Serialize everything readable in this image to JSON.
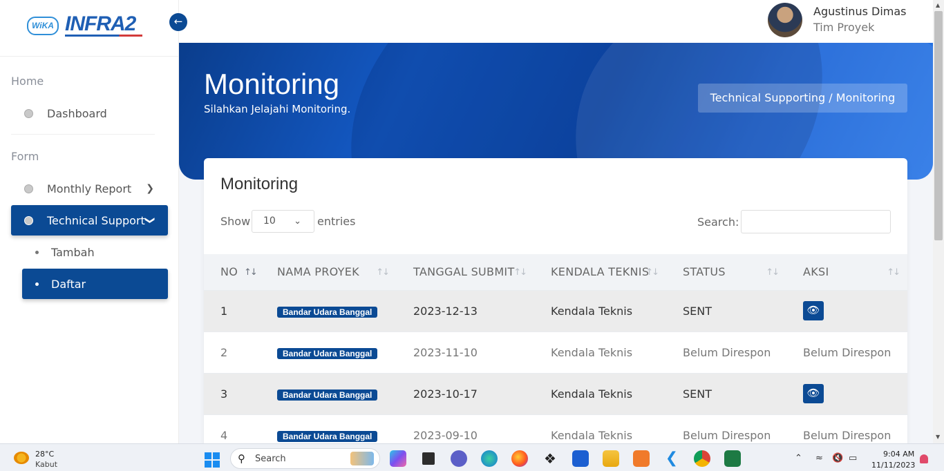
{
  "brand": {
    "logo_left": "WiKA",
    "logo_right": "INFRA2"
  },
  "sidebar": {
    "sections": [
      {
        "label": "Home"
      },
      {
        "label": "Form"
      }
    ],
    "items": [
      {
        "label": "Dashboard"
      },
      {
        "label": "Monthly Report"
      },
      {
        "label": "Technical Support"
      }
    ],
    "subitems": [
      {
        "label": "Tambah"
      },
      {
        "label": "Daftar"
      }
    ]
  },
  "user": {
    "name": "Agustinus Dimas",
    "role": "Tim Proyek"
  },
  "hero": {
    "title": "Monitoring",
    "subtitle": "Silahkan Jelajahi Monitoring.",
    "breadcrumb": "Technical Supporting / Monitoring"
  },
  "card": {
    "title": "Monitoring",
    "show_label": "Show",
    "entries_value": "10",
    "entries_label": "entries",
    "search_label": "Search:",
    "search_value": ""
  },
  "table": {
    "headers": [
      "NO",
      "NAMA PROYEK",
      "TANGGAL SUBMIT",
      "KENDALA TEKNIS",
      "STATUS",
      "AKSI"
    ],
    "rows": [
      {
        "no": "1",
        "proyek": "Bandar Udara Banggal",
        "tanggal": "2023-12-13",
        "kendala": "Kendala Teknis",
        "status": "SENT",
        "aksi": "eye-icon"
      },
      {
        "no": "2",
        "proyek": "Bandar Udara Banggal",
        "tanggal": "2023-11-10",
        "kendala": "Kendala Teknis",
        "status": "Belum Direspon",
        "aksi": "Belum Direspon"
      },
      {
        "no": "3",
        "proyek": "Bandar Udara Banggal",
        "tanggal": "2023-10-17",
        "kendala": "Kendala Teknis",
        "status": "SENT",
        "aksi": "eye-icon"
      },
      {
        "no": "4",
        "proyek": "Bandar Udara Banggal",
        "tanggal": "2023-09-10",
        "kendala": "Kendala Teknis",
        "status": "Belum Direspon",
        "aksi": "Belum Direspon"
      }
    ]
  },
  "taskbar": {
    "weather_temp": "28°C",
    "weather_desc": "Kabut",
    "search_placeholder": "Search",
    "time": "9:04 AM",
    "date": "11/11/2023"
  },
  "colors": {
    "primary": "#0b4a94",
    "hero_start": "#0a3d8c",
    "hero_end": "#2a77e6"
  }
}
